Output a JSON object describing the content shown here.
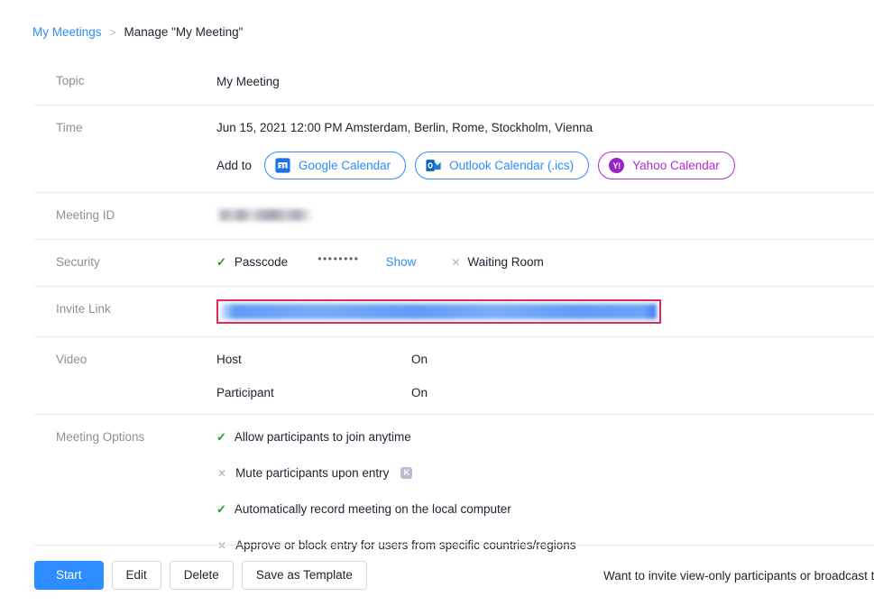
{
  "breadcrumb": {
    "parent": "My Meetings",
    "separator": ">",
    "current": "Manage \"My Meeting\""
  },
  "rows": {
    "topic": {
      "label": "Topic",
      "value": "My Meeting"
    },
    "time": {
      "label": "Time",
      "value": "Jun 15, 2021 12:00 PM Amsterdam, Berlin, Rome, Stockholm, Vienna",
      "add_to_label": "Add to",
      "buttons": [
        {
          "label": "Google Calendar",
          "icon": "google-calendar-icon",
          "accent": "#2d8cff"
        },
        {
          "label": "Outlook Calendar (.ics)",
          "icon": "outlook-calendar-icon",
          "accent": "#2d8cff"
        },
        {
          "label": "Yahoo Calendar",
          "icon": "yahoo-calendar-icon",
          "accent": "#b42ad6"
        }
      ]
    },
    "meeting_id": {
      "label": "Meeting ID",
      "value": ""
    },
    "security": {
      "label": "Security",
      "passcode_label": "Passcode",
      "passcode_enabled": true,
      "passcode_mask": "••••••••",
      "show_link": "Show",
      "waiting_room_label": "Waiting Room",
      "waiting_room_enabled": false
    },
    "invite_link": {
      "label": "Invite Link",
      "value": ""
    },
    "video": {
      "label": "Video",
      "items": [
        {
          "who": "Host",
          "state": "On"
        },
        {
          "who": "Participant",
          "state": "On"
        }
      ]
    },
    "meeting_options": {
      "label": "Meeting Options",
      "items": [
        {
          "text": "Allow participants to join anytime",
          "enabled": true,
          "badge": ""
        },
        {
          "text": "Mute participants upon entry",
          "enabled": false,
          "badge": "K"
        },
        {
          "text": "Automatically record meeting on the local computer",
          "enabled": true,
          "badge": ""
        },
        {
          "text": "Approve or block entry for users from specific countries/regions",
          "enabled": false,
          "badge": ""
        }
      ]
    }
  },
  "actions": {
    "start": "Start",
    "edit": "Edit",
    "delete": "Delete",
    "save_template": "Save as Template",
    "note": "Want to invite view-only participants or broadcast the"
  },
  "colors": {
    "link": "#2d8cff",
    "yahoo": "#b42ad6",
    "enabled_check": "#16a02c",
    "disabled_x": "#b0b0b6",
    "highlight_box": "#e02b52"
  }
}
